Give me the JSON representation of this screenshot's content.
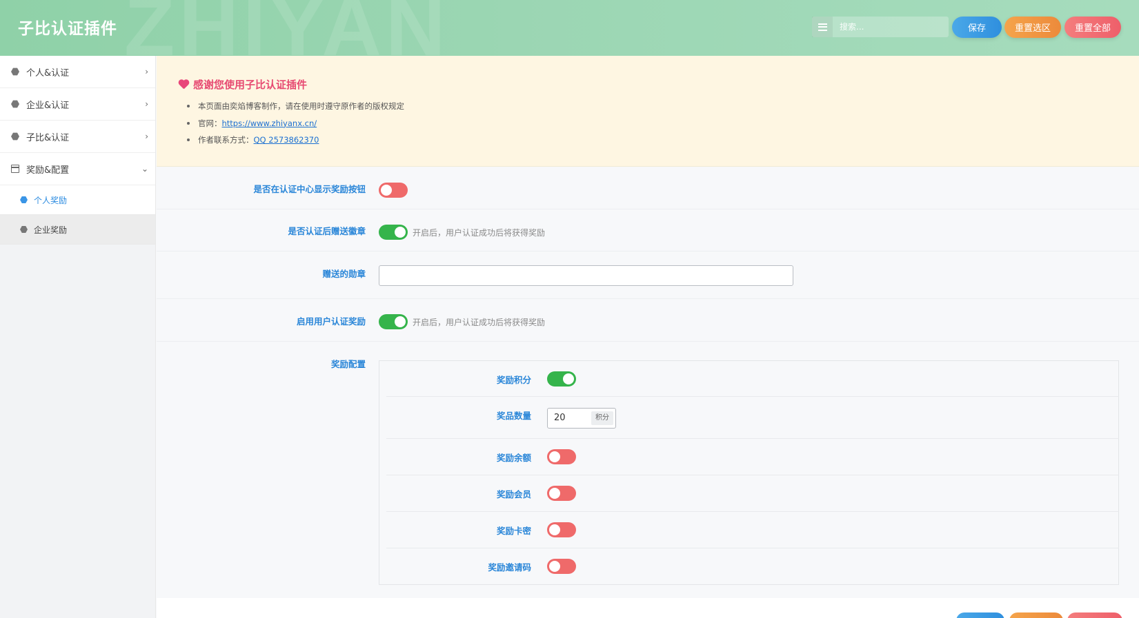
{
  "header": {
    "title": "子比认证插件",
    "watermark": "ZHIYAN",
    "search_placeholder": "搜索...",
    "list_icon": "list-icon",
    "buttons": {
      "save": "保存",
      "reset_section": "重置选区",
      "reset_all": "重置全部"
    },
    "colors": {
      "save": "#2f8fde",
      "reset_section": "#ec8a3b",
      "reset_all": "#ee5f6a"
    }
  },
  "sidebar": {
    "items": [
      {
        "label": "个人&认证",
        "icon": "hexagon-icon",
        "chevron": "›"
      },
      {
        "label": "企业&认证",
        "icon": "hexagon-icon",
        "chevron": "›"
      },
      {
        "label": "子比&认证",
        "icon": "hexagon-icon",
        "chevron": "›"
      },
      {
        "label": "奖励&配置",
        "icon": "calendar-icon",
        "chevron": "⌄"
      }
    ],
    "subitems": [
      {
        "label": "个人奖励",
        "active": true
      },
      {
        "label": "企业奖励",
        "active": false
      }
    ]
  },
  "notice": {
    "title": "感谢您使用子比认证插件",
    "lines": [
      {
        "text": "本页面由奕焰博客制作，请在使用时遵守原作者的版权规定",
        "link": ""
      },
      {
        "text": "官网：",
        "link": "https://www.zhiyanx.cn/"
      },
      {
        "text": "作者联系方式：",
        "link": "QQ 2573862370"
      }
    ]
  },
  "form": {
    "show_button": {
      "label": "是否在认证中心显示奖励按钮",
      "on": false
    },
    "gift_badge": {
      "label": "是否认证后赠送徽章",
      "on": true,
      "hint": "开启后，用户认证成功后将获得奖励"
    },
    "badge_field": {
      "label": "赠送的勋章",
      "value": ""
    },
    "enable_reward": {
      "label": "启用用户认证奖励",
      "on": true,
      "hint": "开启后，用户认证成功后将获得奖励"
    },
    "reward_config": {
      "label": "奖励配置",
      "points": {
        "label": "奖励积分",
        "on": true
      },
      "quantity": {
        "label": "奖品数量",
        "value": "20",
        "unit": "积分"
      },
      "balance": {
        "label": "奖励余额",
        "on": false
      },
      "member": {
        "label": "奖励会员",
        "on": false
      },
      "card": {
        "label": "奖励卡密",
        "on": false
      },
      "invite": {
        "label": "奖励邀请码",
        "on": false
      }
    }
  },
  "colors": {
    "toggle_on": "#35b44b",
    "toggle_off": "#ef6a6a",
    "label_blue": "#2a86d8",
    "notice_bg": "#fef6e2"
  }
}
